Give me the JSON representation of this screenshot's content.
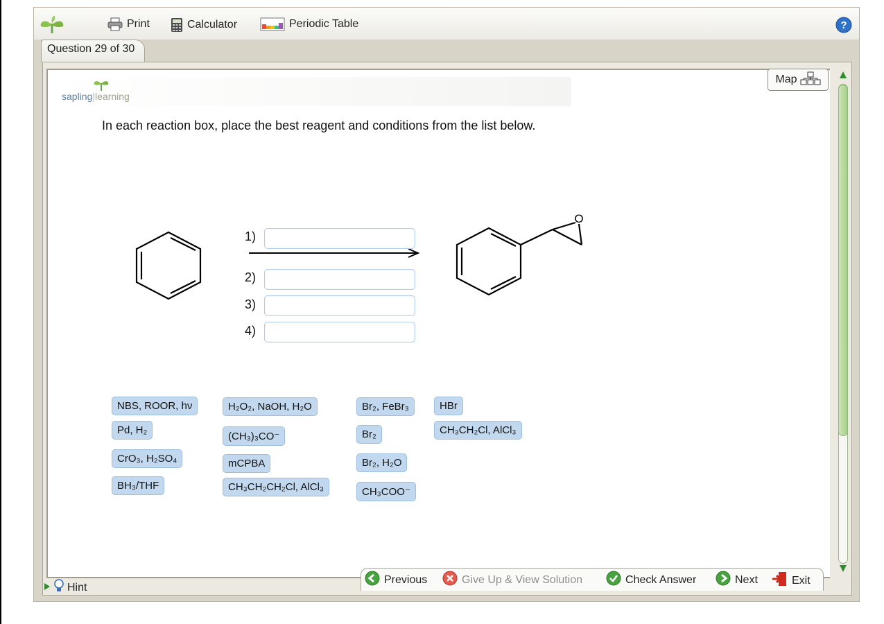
{
  "toolbar": {
    "print_label": "Print",
    "calculator_label": "Calculator",
    "periodic_table_label": "Periodic Table",
    "help_icon": "question-circle-icon"
  },
  "tab": {
    "label": "Question 29 of 30"
  },
  "brand": {
    "part1": "sapling",
    "part2": "learning"
  },
  "map_label": "Map",
  "instruction": "In each reaction box, place the best reagent and conditions from the list below.",
  "reaction": {
    "steps": [
      "1)",
      "2)",
      "3)",
      "4)"
    ],
    "epoxide_oxygen": "O"
  },
  "reagents": {
    "nbs": "NBS, ROOR, hν",
    "pd": "Pd, H₂",
    "cro3": "CrO₃, H₂SO₄",
    "bh3": "BH₃/THF",
    "h2o2": "H₂O₂, NaOH, H₂O",
    "tbuo": "(CH₃)₃CO⁻",
    "mcpba": "mCPBA",
    "prcl": "CH₃CH₂CH₂Cl, AlCl₃",
    "br2febr3": "Br₂, FeBr₃",
    "br2": "Br₂",
    "br2h2o": "Br₂, H₂O",
    "acetate": "CH₃COO⁻",
    "hbr": "HBr",
    "etcl": "CH₃CH₂Cl, AlCl₃"
  },
  "nav": {
    "previous": "Previous",
    "give_up": "Give Up & View Solution",
    "check": "Check Answer",
    "next": "Next",
    "exit": "Exit"
  },
  "hint_label": "Hint",
  "colors": {
    "accent_green": "#3e9a35",
    "reagent_bg": "#c2d8ee",
    "exit_red": "#d12a1f"
  }
}
